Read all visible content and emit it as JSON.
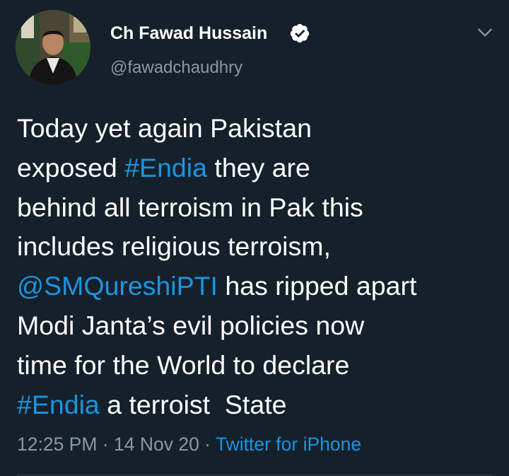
{
  "author": {
    "name": "Ch Fawad Hussain",
    "handle": "@fawadchaudhry",
    "verified": true
  },
  "tweet": {
    "lines": [
      [
        {
          "text": "Today yet again Pakistan",
          "type": "text"
        }
      ],
      [
        {
          "text": "exposed ",
          "type": "text"
        },
        {
          "text": "#Endia",
          "type": "hashtag"
        },
        {
          "text": " they are",
          "type": "text"
        }
      ],
      [
        {
          "text": "behind all terroism in Pak this",
          "type": "text"
        }
      ],
      [
        {
          "text": "includes religious terroism,",
          "type": "text"
        }
      ],
      [
        {
          "text": "@SMQureshiPTI",
          "type": "mention"
        },
        {
          "text": " has ripped apart",
          "type": "text"
        }
      ],
      [
        {
          "text": "Modi Janta’s evil policies now",
          "type": "text"
        }
      ],
      [
        {
          "text": "time for the World to declare",
          "type": "text"
        }
      ],
      [
        {
          "text": "#Endia",
          "type": "hashtag"
        },
        {
          "text": " a terroist  State",
          "type": "text"
        }
      ]
    ]
  },
  "meta": {
    "time": "12:25 PM",
    "separator": " · ",
    "date": "14 Nov 20",
    "source": "Twitter for iPhone"
  },
  "icons": {
    "verified": "verified-badge-icon",
    "menu": "chevron-down-icon"
  },
  "colors": {
    "background": "#15202b",
    "link": "#1b95e0",
    "secondary_text": "#8899a6",
    "primary_text": "#ffffff"
  }
}
